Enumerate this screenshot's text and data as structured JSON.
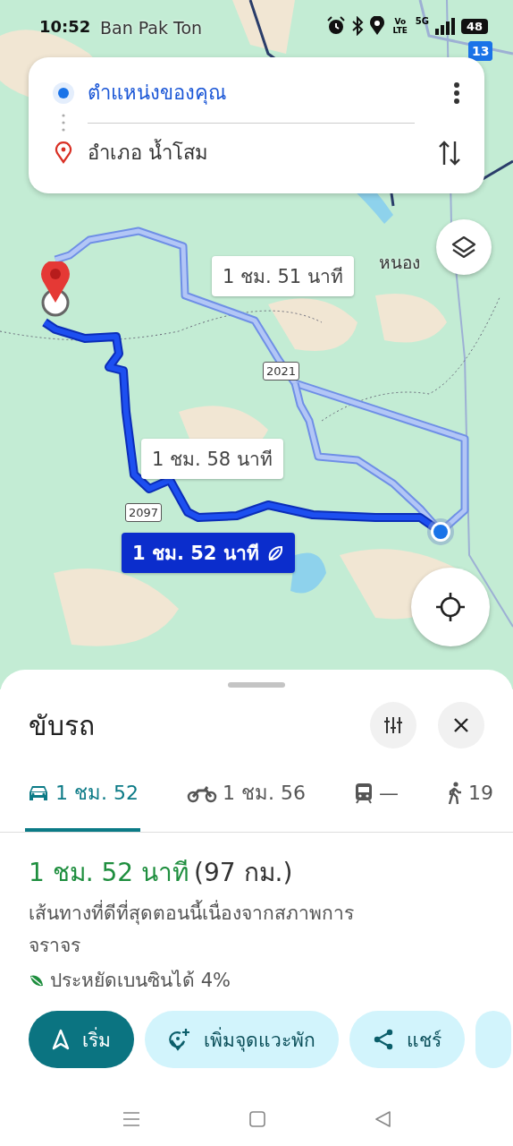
{
  "status_bar": {
    "time": "10:52",
    "volte": "Vo LTE",
    "network": "5G",
    "battery": "48"
  },
  "map": {
    "place_labels": [
      "Ban Pak Ton",
      "หนอง"
    ],
    "road_shields": [
      "13",
      "2021",
      "2097"
    ],
    "routes": [
      {
        "label": "1 ชม. 51 นาที",
        "selected": false,
        "eco": false
      },
      {
        "label": "1 ชม. 58 นาที",
        "selected": false,
        "eco": false
      },
      {
        "label": "1 ชม. 52 นาที",
        "selected": true,
        "eco": true
      }
    ]
  },
  "search": {
    "origin": "ตำแหน่งของคุณ",
    "destination": "อำเภอ น้ำโสม"
  },
  "sheet": {
    "title": "ขับรถ",
    "modes": [
      {
        "kind": "car",
        "label": "1 ชม. 52",
        "selected": true
      },
      {
        "kind": "motorcycle",
        "label": "1 ชม. 56",
        "selected": false
      },
      {
        "kind": "transit",
        "label": "—",
        "selected": false
      },
      {
        "kind": "walk",
        "label": "19",
        "selected": false
      }
    ],
    "summary": {
      "duration": "1 ชม. 52 นาที",
      "distance": "(97 กม.)",
      "description": "เส้นทางที่ดีที่สุดตอนนี้เนื่องจากสภาพการจราจร",
      "eco_note": "ประหยัดเบนซินได้ 4%"
    },
    "actions": [
      {
        "kind": "start",
        "label": "เริ่ม"
      },
      {
        "kind": "add-stop",
        "label": "เพิ่มจุดแวะพัก"
      },
      {
        "kind": "share",
        "label": "แชร์"
      },
      {
        "kind": "more"
      }
    ]
  }
}
